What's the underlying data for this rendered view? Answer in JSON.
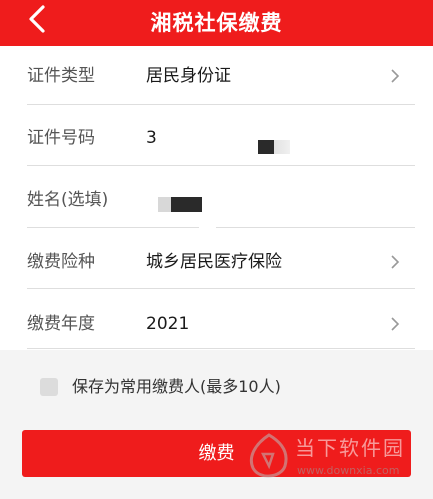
{
  "header": {
    "title": "湘税社保缴费"
  },
  "form": {
    "rows": [
      {
        "label": "证件类型",
        "value": "居民身份证"
      },
      {
        "label": "证件号码",
        "value": "3"
      },
      {
        "label": "姓名(选填)",
        "value": ""
      },
      {
        "label": "缴费险种",
        "value": "城乡居民医疗保险"
      },
      {
        "label": "缴费年度",
        "value": "2021"
      }
    ]
  },
  "save_common": {
    "label": "保存为常用缴费人(最多10人)",
    "checked": false
  },
  "pay_button": {
    "label": "缴费"
  },
  "watermark": {
    "name": "当下软件园",
    "url": "www.downxia.com"
  },
  "colors": {
    "accent": "#ef1c1c",
    "background": "#f4f4f4",
    "card": "#ffffff",
    "divider": "#dedede"
  }
}
